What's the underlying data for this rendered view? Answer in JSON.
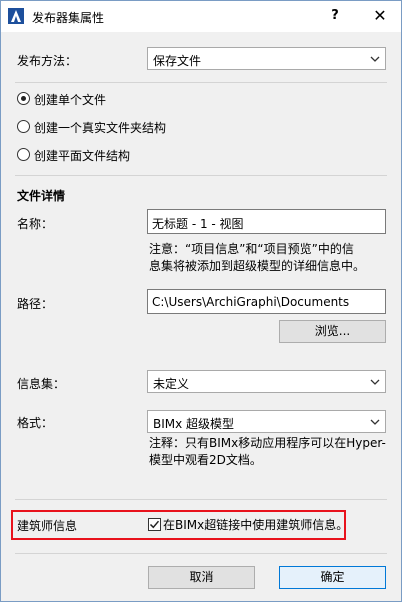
{
  "window": {
    "title": "发布器集属性",
    "help_glyph": "?",
    "close_glyph": "✕"
  },
  "publish_method": {
    "label": "发布方法：",
    "value": "保存文件"
  },
  "structure_options": [
    {
      "label": "创建单个文件",
      "selected": true
    },
    {
      "label": "创建一个真实文件夹结构",
      "selected": false
    },
    {
      "label": "创建平面文件结构",
      "selected": false
    }
  ],
  "file_details": {
    "heading": "文件详情",
    "name_label": "名称：",
    "name_value": "无标题 - 1 - 视图",
    "name_note_line1": "注意：“项目信息”和“项目预览”中的信",
    "name_note_line2": "息集将被添加到超级模型的详细信息中。",
    "path_label": "路径：",
    "path_value": "C:\\Users\\ArchiGraphi\\Documents",
    "browse_label": "浏览..."
  },
  "info_set": {
    "label": "信息集：",
    "value": "未定义"
  },
  "format": {
    "label": "格式：",
    "value": "BIMx 超级模型",
    "note_line1": "注释：只有BIMx移动应用程序可以在Hyper-",
    "note_line2": "模型中观看2D文档。"
  },
  "architect_info": {
    "label": "建筑师信息",
    "checkbox_label": "在BIMx超链接中使用建筑师信息。",
    "checked": true
  },
  "footer": {
    "cancel_label": "取消",
    "ok_label": "确定"
  },
  "colors": {
    "highlight_border": "#e8121c",
    "primary_button_border": "#0078d7"
  }
}
